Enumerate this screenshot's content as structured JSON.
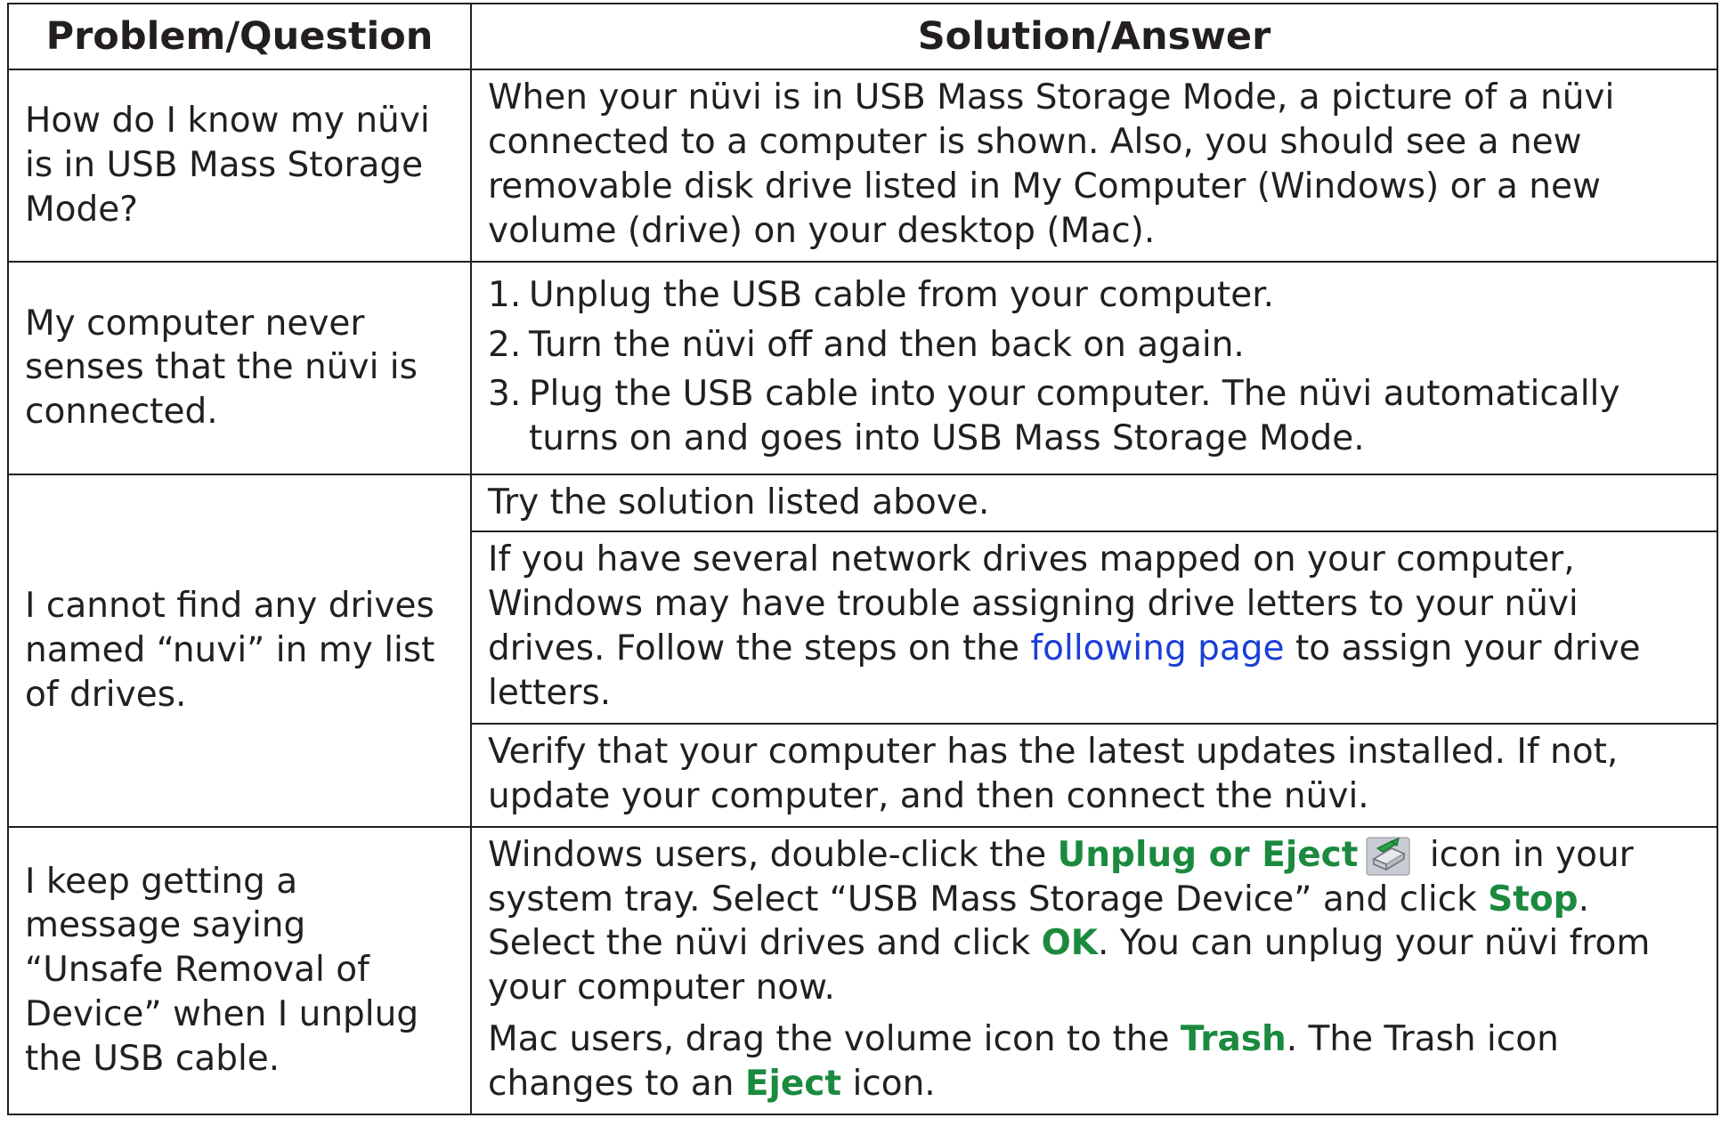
{
  "header": {
    "col1": "Problem/Question",
    "col2": "Solution/Answer"
  },
  "rows": [
    {
      "question": "How do I know my nüvi is in USB Mass Storage Mode?",
      "answer": "When your nüvi is in USB Mass Storage Mode, a picture of a nüvi connected to a computer is shown. Also, you should see a new removable disk drive listed in My Computer (Windows) or a new volume (drive) on your desktop (Mac)."
    },
    {
      "question": "My computer never senses that the nüvi is connected.",
      "steps": [
        {
          "num": "1.",
          "text": "Unplug the USB cable from your computer."
        },
        {
          "num": "2.",
          "text": "Turn the nüvi off and then back on again."
        },
        {
          "num": "3.",
          "text": "Plug the USB cable into your computer. The nüvi automatically turns on and goes into USB Mass Storage Mode."
        }
      ]
    },
    {
      "question": "I cannot find any drives named “nuvi” in my list of drives.",
      "answers": {
        "a1": "Try the solution listed above.",
        "a2_pre": "If you have several network drives mapped on your computer, Windows may have trouble assigning drive letters to your nüvi drives. Follow the steps on the ",
        "a2_link": "following page",
        "a2_post": " to assign your drive letters.",
        "a3": "Verify that your computer has the latest updates installed. If not, update your computer, and then connect the nüvi."
      }
    },
    {
      "question": "I keep getting a message saying “Unsafe Removal of Device” when I unplug the USB cable.",
      "win": {
        "t1": "Windows users, double-click the ",
        "b1": "Unplug or Eject",
        "t2": " icon in your system tray. Select “USB Mass Storage Device” and click ",
        "b2": "Stop",
        "t3": ". Select the nüvi drives and click ",
        "b3": "OK",
        "t4": ". You can unplug your nüvi from your computer now."
      },
      "mac": {
        "t1": "Mac users, drag the volume icon to the ",
        "b1": "Trash",
        "t2": ". The Trash icon changes to an ",
        "b2": "Eject",
        "t3": " icon."
      }
    }
  ],
  "colors": {
    "highlight": "#1b8a3f",
    "link": "#1a3fd6",
    "text": "#231f20"
  },
  "icons": {
    "eject": "unplug-or-eject-icon"
  }
}
